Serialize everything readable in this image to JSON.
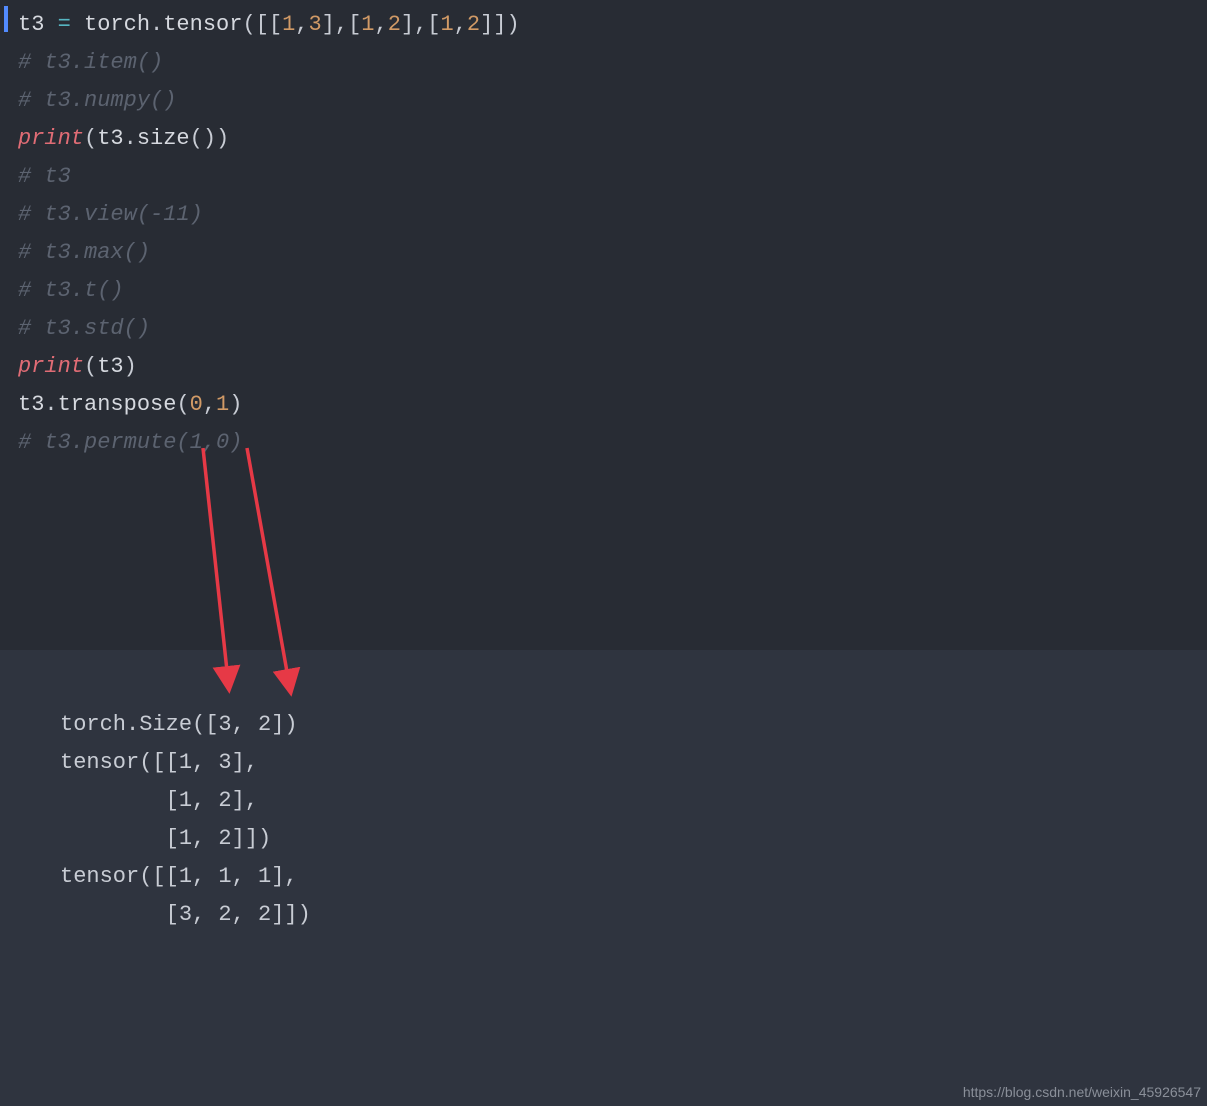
{
  "code": {
    "l1_var": "t3",
    "l1_assign": " = ",
    "l1_mod": "torch",
    "l1_dot1": ".",
    "l1_fn": "tensor",
    "l1_open": "([[",
    "l1_n1": "1",
    "l1_c1": ",",
    "l1_n2": "3",
    "l1_m1": "],[",
    "l1_n3": "1",
    "l1_c2": ",",
    "l1_n4": "2",
    "l1_m2": "],[",
    "l1_n5": "1",
    "l1_c3": ",",
    "l1_n6": "2",
    "l1_close": "]])",
    "l2": "# t3.item()",
    "l3": "# t3.numpy()",
    "l4_fn": "print",
    "l4_p1": "(",
    "l4_v": "t3",
    "l4_d": ".",
    "l4_m": "size",
    "l4_p2": "())",
    "l5": "# t3",
    "l6": "# t3.view(-11)",
    "l7": "# t3.max()",
    "l8": "# t3.t()",
    "l9": "# t3.std()",
    "l10_fn": "print",
    "l10_p1": "(",
    "l10_v": "t3",
    "l10_p2": ")",
    "l11": "",
    "l12_v": "t3",
    "l12_d": ".",
    "l12_m": "transpose",
    "l12_p1": "(",
    "l12_n1": "0",
    "l12_c": ",",
    "l12_n2": "1",
    "l12_p2": ")",
    "l13": "# t3.permute(1,0)"
  },
  "output": {
    "o1": "torch.Size([3, 2])",
    "o2": "tensor([[1, 3],",
    "o3": "        [1, 2],",
    "o4": "        [1, 2]])",
    "o5": "",
    "o6": "",
    "o7": "",
    "o8": "tensor([[1, 1, 1],",
    "o9": "        [3, 2, 2]])"
  },
  "watermark": "https://blog.csdn.net/weixin_45926547"
}
